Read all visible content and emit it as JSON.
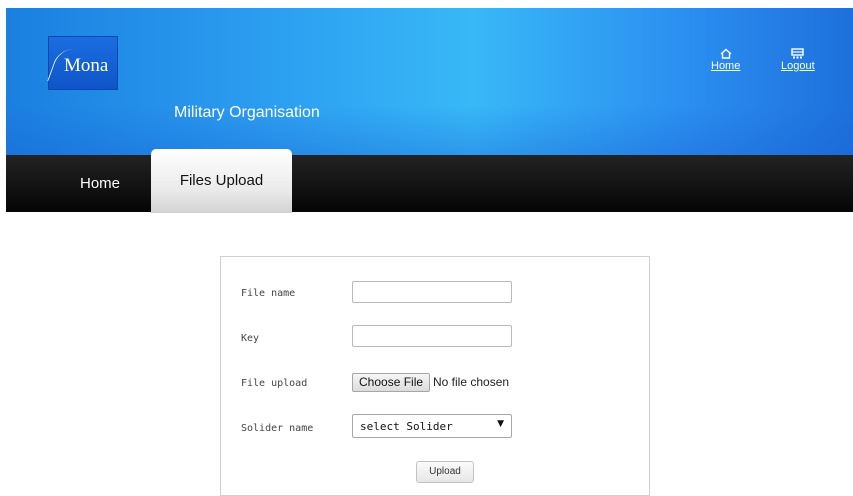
{
  "header": {
    "logo_text": "Mona",
    "subtitle": "Military Organisation",
    "links": {
      "home": "Home",
      "logout": "Logout"
    }
  },
  "nav": {
    "tabs": [
      {
        "label": "Home",
        "active": false
      },
      {
        "label": "Files Upload",
        "active": true
      }
    ]
  },
  "form": {
    "file_name": {
      "label": "File name",
      "value": ""
    },
    "key": {
      "label": "Key",
      "value": ""
    },
    "file_upload": {
      "label": "File upload",
      "button": "Choose File",
      "status": "No file chosen"
    },
    "soldier": {
      "label": "Solider name",
      "selected": "select Solider"
    },
    "submit": "Upload"
  },
  "colors": {
    "header_blue": "#2b9df0",
    "navbar_black": "#0a0a0a",
    "active_tab": "#e6e6e6"
  },
  "icons": {
    "home": "house-icon",
    "logout": "logout-icon",
    "dropdown": "chevron-down-icon"
  }
}
